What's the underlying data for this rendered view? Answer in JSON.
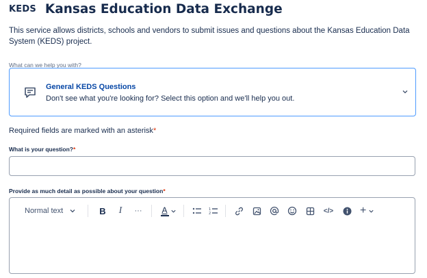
{
  "header": {
    "logo": "KEDS",
    "title": "Kansas Education Data Exchange"
  },
  "intro": "This service allows districts, schools and vendors to submit issues and questions about the Kansas Education Data System (KEDS) project.",
  "request_type": {
    "label": "What can we help you with?",
    "selected_title": "General KEDS Questions",
    "selected_description": "Don't see what you're looking for? Select this option and we'll help you out.",
    "icon": "chat-message-icon"
  },
  "required_note": {
    "text": "Required fields are marked with an asterisk",
    "asterisk": "*"
  },
  "question_field": {
    "label": "What is your question?",
    "asterisk": "*",
    "value": ""
  },
  "details_field": {
    "label": "Provide as much detail as possible about your question",
    "asterisk": "*",
    "toolbar": {
      "text_style": "Normal text",
      "bold": "B",
      "italic": "I",
      "more": "···",
      "text_color": "A",
      "code": "</>",
      "insert": "+"
    }
  },
  "colors": {
    "accent": "#4c9aff",
    "title": "#172b4d",
    "link": "#0747a6",
    "required": "#de350b",
    "border": "#97a0af"
  }
}
